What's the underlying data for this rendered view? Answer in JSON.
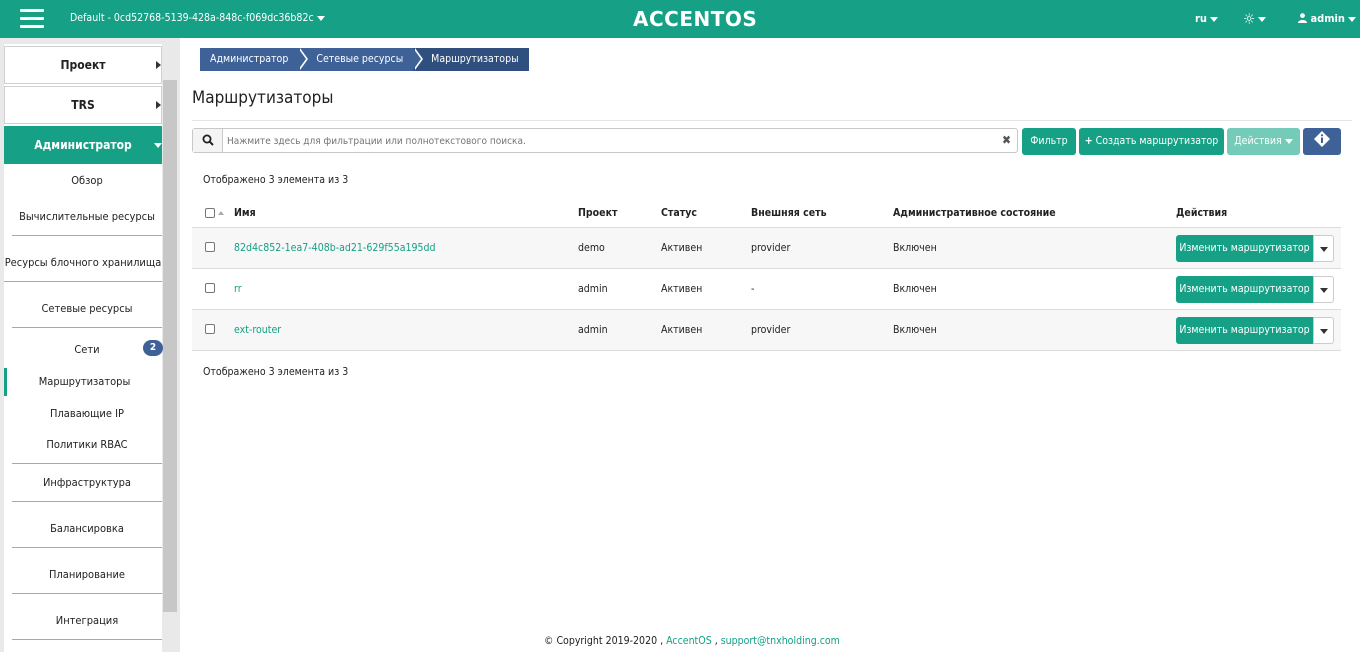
{
  "header": {
    "project": "Default - 0cd52768-5139-428a-848c-f069dc36b82c",
    "logo": "ACCENTOS",
    "lang": "ru",
    "user": "admin"
  },
  "sidebar": {
    "project": "Проект",
    "trs": "TRS",
    "admin": "Администратор",
    "items": {
      "overview": "Обзор",
      "compute": "Вычислительные ресурсы",
      "block": "Ресурсы блочного хранилища",
      "network": "Сетевые ресурсы",
      "networks": "Сети",
      "networks_badge": "2",
      "routers": "Маршрутизаторы",
      "floating": "Плавающие IP",
      "rbac": "Политики RBAC",
      "infra": "Инфраструктура",
      "balancing": "Балансировка",
      "planning": "Планирование",
      "integration": "Интеграция"
    }
  },
  "breadcrumb": [
    "Администратор",
    "Сетевые ресурсы",
    "Маршрутизаторы"
  ],
  "page": {
    "title": "Маршрутизаторы",
    "search_placeholder": "Нажмите здесь для фильтрации или полнотекстового поиска.",
    "filter_button": "Фильтр",
    "create_button": "Создать маршрутизатор",
    "actions_button": "Действия",
    "count_top": "Отображено 3 элемента из 3",
    "count_bottom": "Отображено 3 элемента из 3"
  },
  "table": {
    "columns": {
      "name": "Имя",
      "project": "Проект",
      "status": "Статус",
      "ext_net": "Внешняя сеть",
      "admin_state": "Административное состояние",
      "actions": "Действия"
    },
    "rows": [
      {
        "name": "82d4c852-1ea7-408b-ad21-629f55a195dd",
        "project": "demo",
        "status": "Активен",
        "ext_net": "provider",
        "admin_state": "Включен",
        "action": "Изменить маршрутизатор"
      },
      {
        "name": "rr",
        "project": "admin",
        "status": "Активен",
        "ext_net": "-",
        "admin_state": "Включен",
        "action": "Изменить маршрутизатор"
      },
      {
        "name": "ext-router",
        "project": "admin",
        "status": "Активен",
        "ext_net": "provider",
        "admin_state": "Включен",
        "action": "Изменить маршрутизатор"
      }
    ]
  },
  "footer": {
    "copyright": "© Copyright 2019-2020 ,",
    "brand": "AccentOS",
    "sep": ",",
    "email": "support@tnxholding.com"
  },
  "colors": {
    "accent": "#16a085",
    "breadcrumb": "#3e6197",
    "info_button": "#3e6197"
  }
}
